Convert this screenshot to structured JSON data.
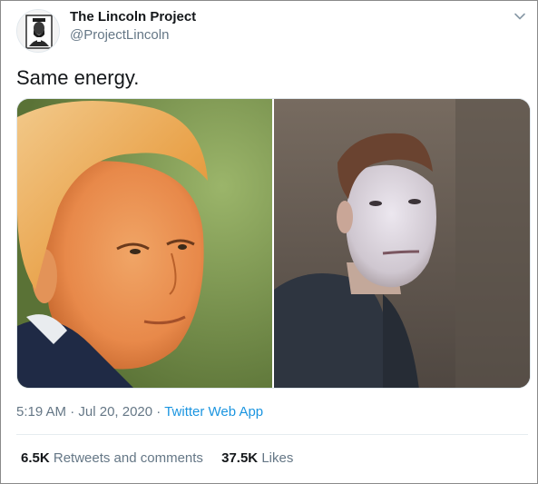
{
  "author": {
    "name": "The Lincoln Project",
    "handle": "@ProjectLincoln"
  },
  "tweet": {
    "text": "Same energy.",
    "time": "5:19 AM",
    "separator": "·",
    "date": "Jul 20, 2020",
    "via": "Twitter Web App"
  },
  "stats": {
    "retweets_count": "6.5K",
    "retweets_label": "Retweets and comments",
    "likes_count": "37.5K",
    "likes_label": "Likes"
  },
  "icons": {
    "menu": "chevron-down-icon"
  },
  "colors": {
    "link": "#1b95e0",
    "secondary_text": "#657786",
    "primary_text": "#14171a"
  }
}
